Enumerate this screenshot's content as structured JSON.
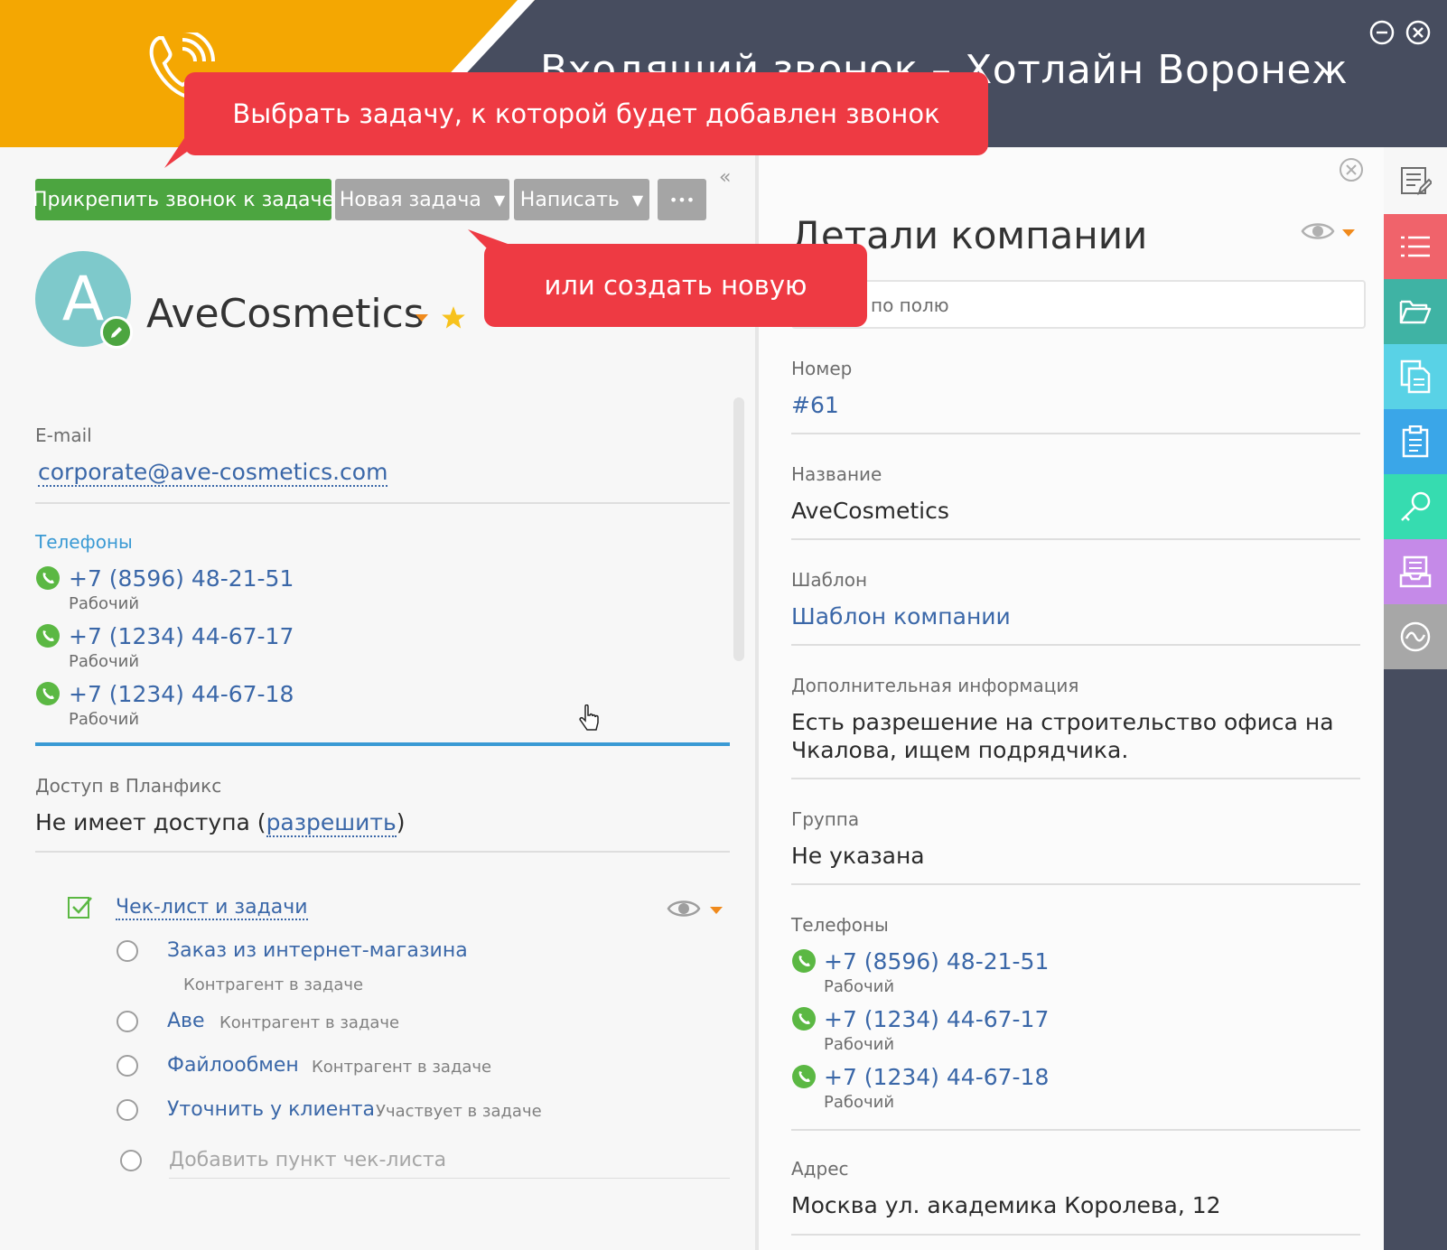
{
  "header": {
    "title": "Входящий звонок – Хотлайн Воронеж",
    "colors": {
      "yellow": "#f4a702",
      "dark": "#474d5f"
    }
  },
  "callouts": {
    "select_task": "Выбрать задачу, к которой будет добавлен звонок",
    "create_new": "или создать новую"
  },
  "toolbar": {
    "attach_label": "Прикрепить звонок к задаче",
    "new_task_label": "Новая задача",
    "write_label": "Написать",
    "more_label": "•••"
  },
  "contact": {
    "avatar_letter": "A",
    "name": "AveCosmetics",
    "email_label": "E-mail",
    "email": "corporate@ave-cosmetics.com",
    "phones_label": "Телефоны",
    "phones": [
      {
        "number": "+7 (8596) 48-21-51",
        "type": "Рабочий"
      },
      {
        "number": "+7 (1234) 44-67-17",
        "type": "Рабочий"
      },
      {
        "number": "+7 (1234) 44-67-18",
        "type": "Рабочий"
      }
    ],
    "access_label": "Доступ в Планфикс",
    "access_text": "Не имеет доступа (",
    "access_link": "разрешить",
    "access_close": ")"
  },
  "checklist": {
    "title": "Чек-лист и задачи",
    "items": [
      {
        "title": "Заказ из интернет-магазина",
        "role": "Контрагент в задаче"
      },
      {
        "title": "Аве",
        "role": "Контрагент в задаче"
      },
      {
        "title": "Файлообмен",
        "role": "Контрагент в задаче"
      },
      {
        "title": "Уточнить у клиента",
        "role": "Участвует в задаче"
      }
    ],
    "add_placeholder": "Добавить пункт чек-листа"
  },
  "details": {
    "title": "Детали компании",
    "search_placeholder": "по полю",
    "fields": {
      "number_label": "Номер",
      "number_value": "#61",
      "name_label": "Название",
      "name_value": "AveCosmetics",
      "template_label": "Шаблон",
      "template_value": "Шаблон компании",
      "extra_label": "Дополнительная информация",
      "extra_line1": "Есть разрешение на строительство офиса на",
      "extra_line2": "Чкалова, ищем подрядчика.",
      "group_label": "Группа",
      "group_value": "Не указана",
      "phones_label": "Телефоны",
      "address_label": "Адрес",
      "address_value": "Москва ул. академика Королева, 12"
    },
    "phones": [
      {
        "number": "+7 (8596) 48-21-51",
        "type": "Рабочий"
      },
      {
        "number": "+7 (1234) 44-67-17",
        "type": "Рабочий"
      },
      {
        "number": "+7 (1234) 44-67-18",
        "type": "Рабочий"
      }
    ]
  },
  "sidebar": {
    "items": [
      {
        "icon": "list-icon",
        "color": "#f0636b"
      },
      {
        "icon": "folder-icon",
        "color": "#3fb3a4"
      },
      {
        "icon": "document-icon",
        "color": "#59d2e6"
      },
      {
        "icon": "clipboard-icon",
        "color": "#3aa6e8"
      },
      {
        "icon": "key-icon",
        "color": "#36dcb0"
      },
      {
        "icon": "inbox-icon",
        "color": "#c58ae8"
      },
      {
        "icon": "analytics-icon",
        "color": "#a7a7a7"
      }
    ]
  }
}
